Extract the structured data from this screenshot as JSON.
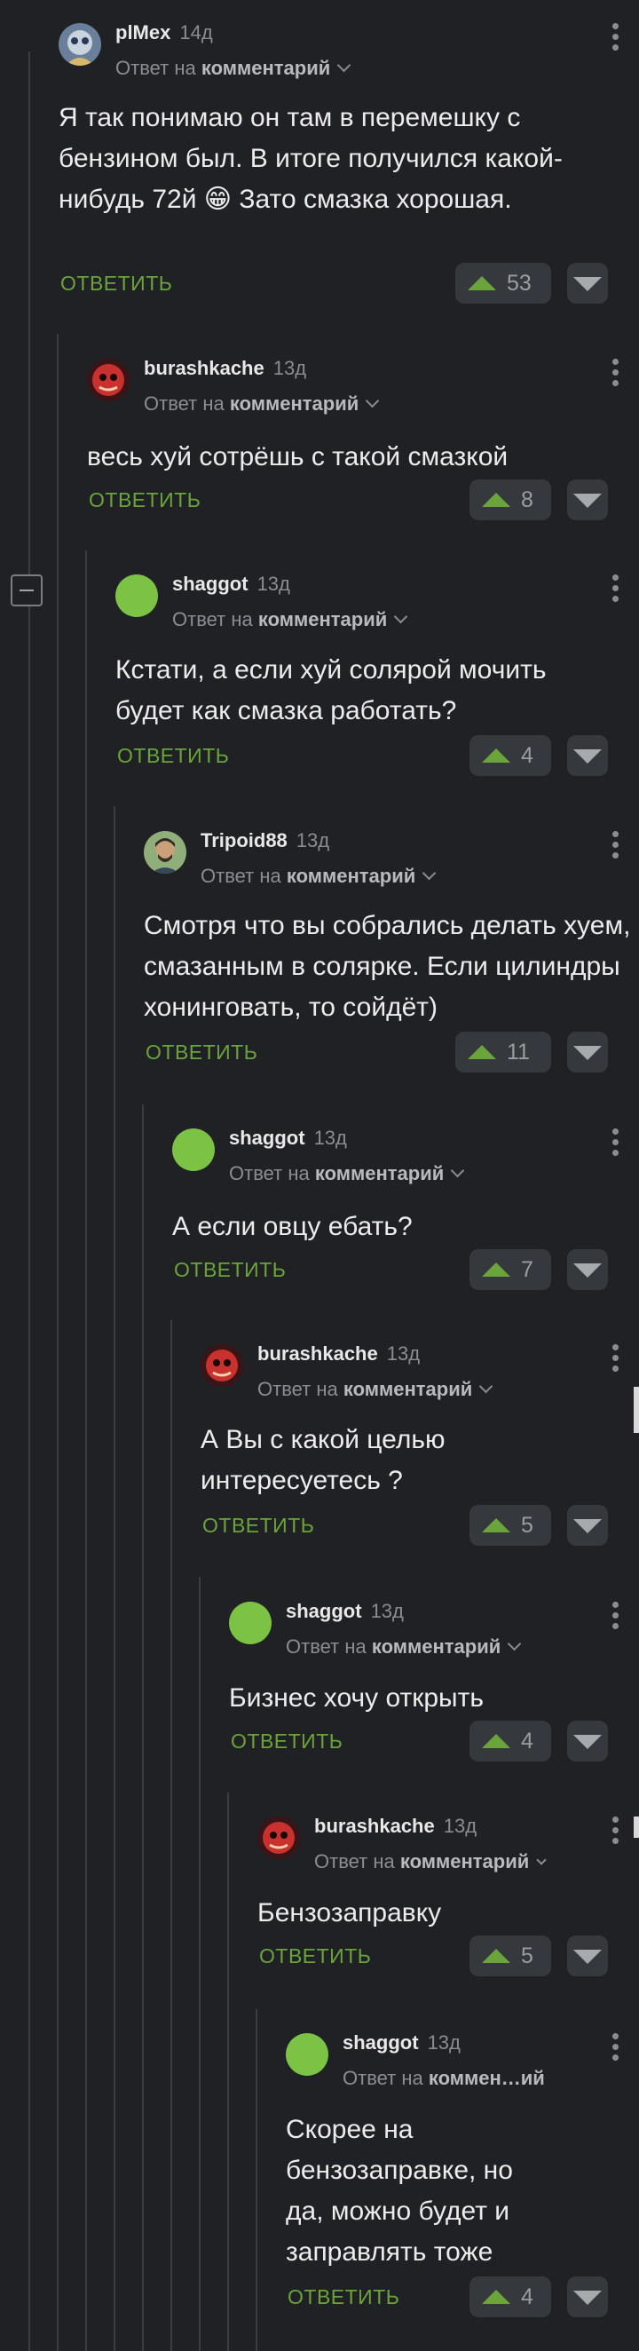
{
  "reply_prefix": "Ответ на",
  "reply_button_label": "ОТВЕТИТЬ",
  "comments": [
    {
      "username": "plMex",
      "time": "14д",
      "reply_target": "комментарий",
      "text": "Я так понимаю он там в перемешку с бензином был. В итоге получился какой-нибудь 72й 😁 Зато смазка хорошая.",
      "votes": "53"
    },
    {
      "username": "burashkache",
      "time": "13д",
      "reply_target": "комментарий",
      "text": "весь хуй сотрёшь с такой смазкой",
      "votes": "8"
    },
    {
      "username": "shaggot",
      "time": "13д",
      "reply_target": "комментарий",
      "text": "Кстати, а если хуй солярой мочить будет как смазка работать?",
      "votes": "4"
    },
    {
      "username": "Tripoid88",
      "time": "13д",
      "reply_target": "комментарий",
      "text": "Смотря что вы собрались делать хуем, смазанным в солярке. Если цилиндры хонинговать, то сойдёт)",
      "votes": "11"
    },
    {
      "username": "shaggot",
      "time": "13д",
      "reply_target": "комментарий",
      "text": "А если овцу ебать?",
      "votes": "7"
    },
    {
      "username": "burashkache",
      "time": "13д",
      "reply_target": "комментарий",
      "text": "А Вы с какой целью интересуетесь ?",
      "votes": "5"
    },
    {
      "username": "shaggot",
      "time": "13д",
      "reply_target": "комментарий",
      "text": "Бизнес хочу открыть",
      "votes": "4"
    },
    {
      "username": "burashkache",
      "time": "13д",
      "reply_target": "комментарий",
      "text": "Бензозаправку",
      "votes": "5"
    },
    {
      "username": "shaggot",
      "time": "13д",
      "reply_target": "коммен…ий",
      "text": "Скорее на бензозаправке, но да, можно будет и заправлять тоже",
      "votes": "4"
    }
  ],
  "icons": {
    "menu": "kebab-dots-icon",
    "upvote": "arrow-up-icon",
    "downvote": "arrow-down-icon",
    "collapse": "minus-icon"
  },
  "colors": {
    "background": "#1f2124",
    "accent_green": "#6aa43a",
    "avatar_green": "#7cc244",
    "thread_line": "#3a3d41"
  }
}
